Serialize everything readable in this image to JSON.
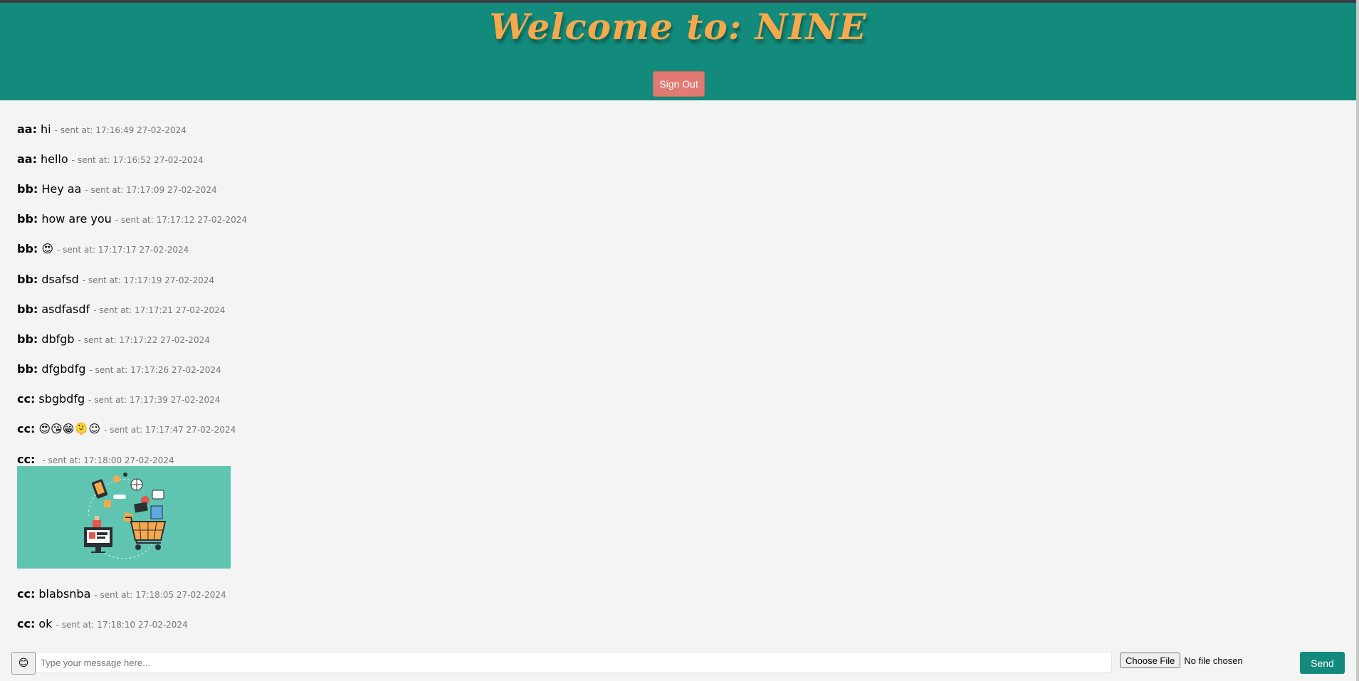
{
  "header": {
    "title": "Welcome to: NINE",
    "sign_out_label": "Sign Out"
  },
  "messages": [
    {
      "user": "aa:",
      "text": "hi",
      "time": "- sent at: 17:16:49 27-02-2024"
    },
    {
      "user": "aa:",
      "text": "hello",
      "time": "- sent at: 17:16:52 27-02-2024"
    },
    {
      "user": "bb:",
      "text": "Hey aa",
      "time": "- sent at: 17:17:09 27-02-2024"
    },
    {
      "user": "bb:",
      "text": "how are you",
      "time": "- sent at: 17:17:12 27-02-2024"
    },
    {
      "user": "bb:",
      "text": "😍",
      "time": "- sent at: 17:17:17 27-02-2024"
    },
    {
      "user": "bb:",
      "text": "dsafsd",
      "time": "- sent at: 17:17:19 27-02-2024"
    },
    {
      "user": "bb:",
      "text": "asdfasdf",
      "time": "- sent at: 17:17:21 27-02-2024"
    },
    {
      "user": "bb:",
      "text": "dbfgb",
      "time": "- sent at: 17:17:22 27-02-2024"
    },
    {
      "user": "bb:",
      "text": "dfgbdfg",
      "time": "- sent at: 17:17:26 27-02-2024"
    },
    {
      "user": "cc:",
      "text": "sbgbdfg",
      "time": "- sent at: 17:17:39 27-02-2024"
    },
    {
      "user": "cc:",
      "text": "😍😘😁🫠☺",
      "time": "- sent at: 17:17:47 27-02-2024"
    },
    {
      "user": "cc:",
      "text": "",
      "time": "- sent at: 17:18:00 27-02-2024"
    },
    {
      "user": "cc:",
      "text": "blabsnba",
      "time": "- sent at: 17:18:05 27-02-2024"
    },
    {
      "user": "cc:",
      "text": "ok",
      "time": "- sent at: 17:18:10 27-02-2024"
    }
  ],
  "composer": {
    "emoji_button": "😊",
    "placeholder": "Type your message here...",
    "value": "",
    "file_button_label": "Choose File",
    "file_status": "No file chosen",
    "send_label": "Send"
  },
  "colors": {
    "header_bg": "#138b7c",
    "title_color": "#f5a94c",
    "sign_out_bg": "#e07a72",
    "send_bg": "#138b7c",
    "attachment_bg": "#5fc4b0"
  }
}
